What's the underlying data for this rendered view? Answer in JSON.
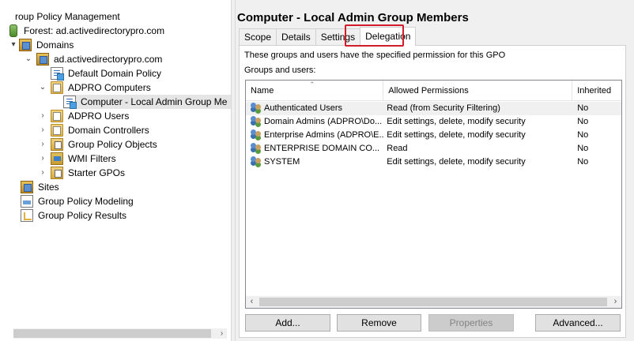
{
  "tree": {
    "items": [
      {
        "label": "roup Policy Management",
        "icon": "group-policy-icon"
      },
      {
        "label": "Forest: ad.activedirectorypro.com",
        "icon": "forest-icon"
      },
      {
        "label": "Domains",
        "icon": "domains-icon"
      },
      {
        "label": "ad.activedirectorypro.com",
        "icon": "domain-icon"
      },
      {
        "label": "Default Domain Policy",
        "icon": "gpo-link-icon"
      },
      {
        "label": "ADPRO Computers",
        "icon": "ou-icon"
      },
      {
        "label": "Computer - Local Admin Group Me",
        "icon": "gpo-link-icon"
      },
      {
        "label": "ADPRO Users",
        "icon": "ou-icon"
      },
      {
        "label": "Domain Controllers",
        "icon": "ou-icon"
      },
      {
        "label": "Group Policy Objects",
        "icon": "gpo-folder-icon"
      },
      {
        "label": "WMI Filters",
        "icon": "wmi-filter-icon"
      },
      {
        "label": "Starter GPOs",
        "icon": "starter-gpo-icon"
      },
      {
        "label": "Sites",
        "icon": "sites-icon"
      },
      {
        "label": "Group Policy Modeling",
        "icon": "modeling-icon"
      },
      {
        "label": "Group Policy Results",
        "icon": "results-icon"
      }
    ]
  },
  "details": {
    "title": "Computer - Local Admin Group Members",
    "tabs": [
      {
        "label": "Scope"
      },
      {
        "label": "Details"
      },
      {
        "label": "Settings"
      },
      {
        "label": "Delegation"
      }
    ],
    "active_tab": "Delegation",
    "highlight_color": "#d31c2a",
    "description": "These groups and users have the specified permission for this GPO",
    "groups_label": "Groups and users:",
    "columns": [
      "Name",
      "Allowed Permissions",
      "Inherited"
    ],
    "rows": [
      {
        "name": "Authenticated Users",
        "permissions": "Read (from Security Filtering)",
        "inherited": "No"
      },
      {
        "name": "Domain Admins (ADPRO\\Do...",
        "permissions": "Edit settings, delete, modify security",
        "inherited": "No"
      },
      {
        "name": "Enterprise Admins (ADPRO\\E...",
        "permissions": "Edit settings, delete, modify security",
        "inherited": "No"
      },
      {
        "name": "ENTERPRISE DOMAIN CO...",
        "permissions": "Read",
        "inherited": "No"
      },
      {
        "name": "SYSTEM",
        "permissions": "Edit settings, delete, modify security",
        "inherited": "No"
      }
    ],
    "buttons": {
      "add": "Add...",
      "remove": "Remove",
      "properties": "Properties",
      "advanced": "Advanced..."
    }
  }
}
